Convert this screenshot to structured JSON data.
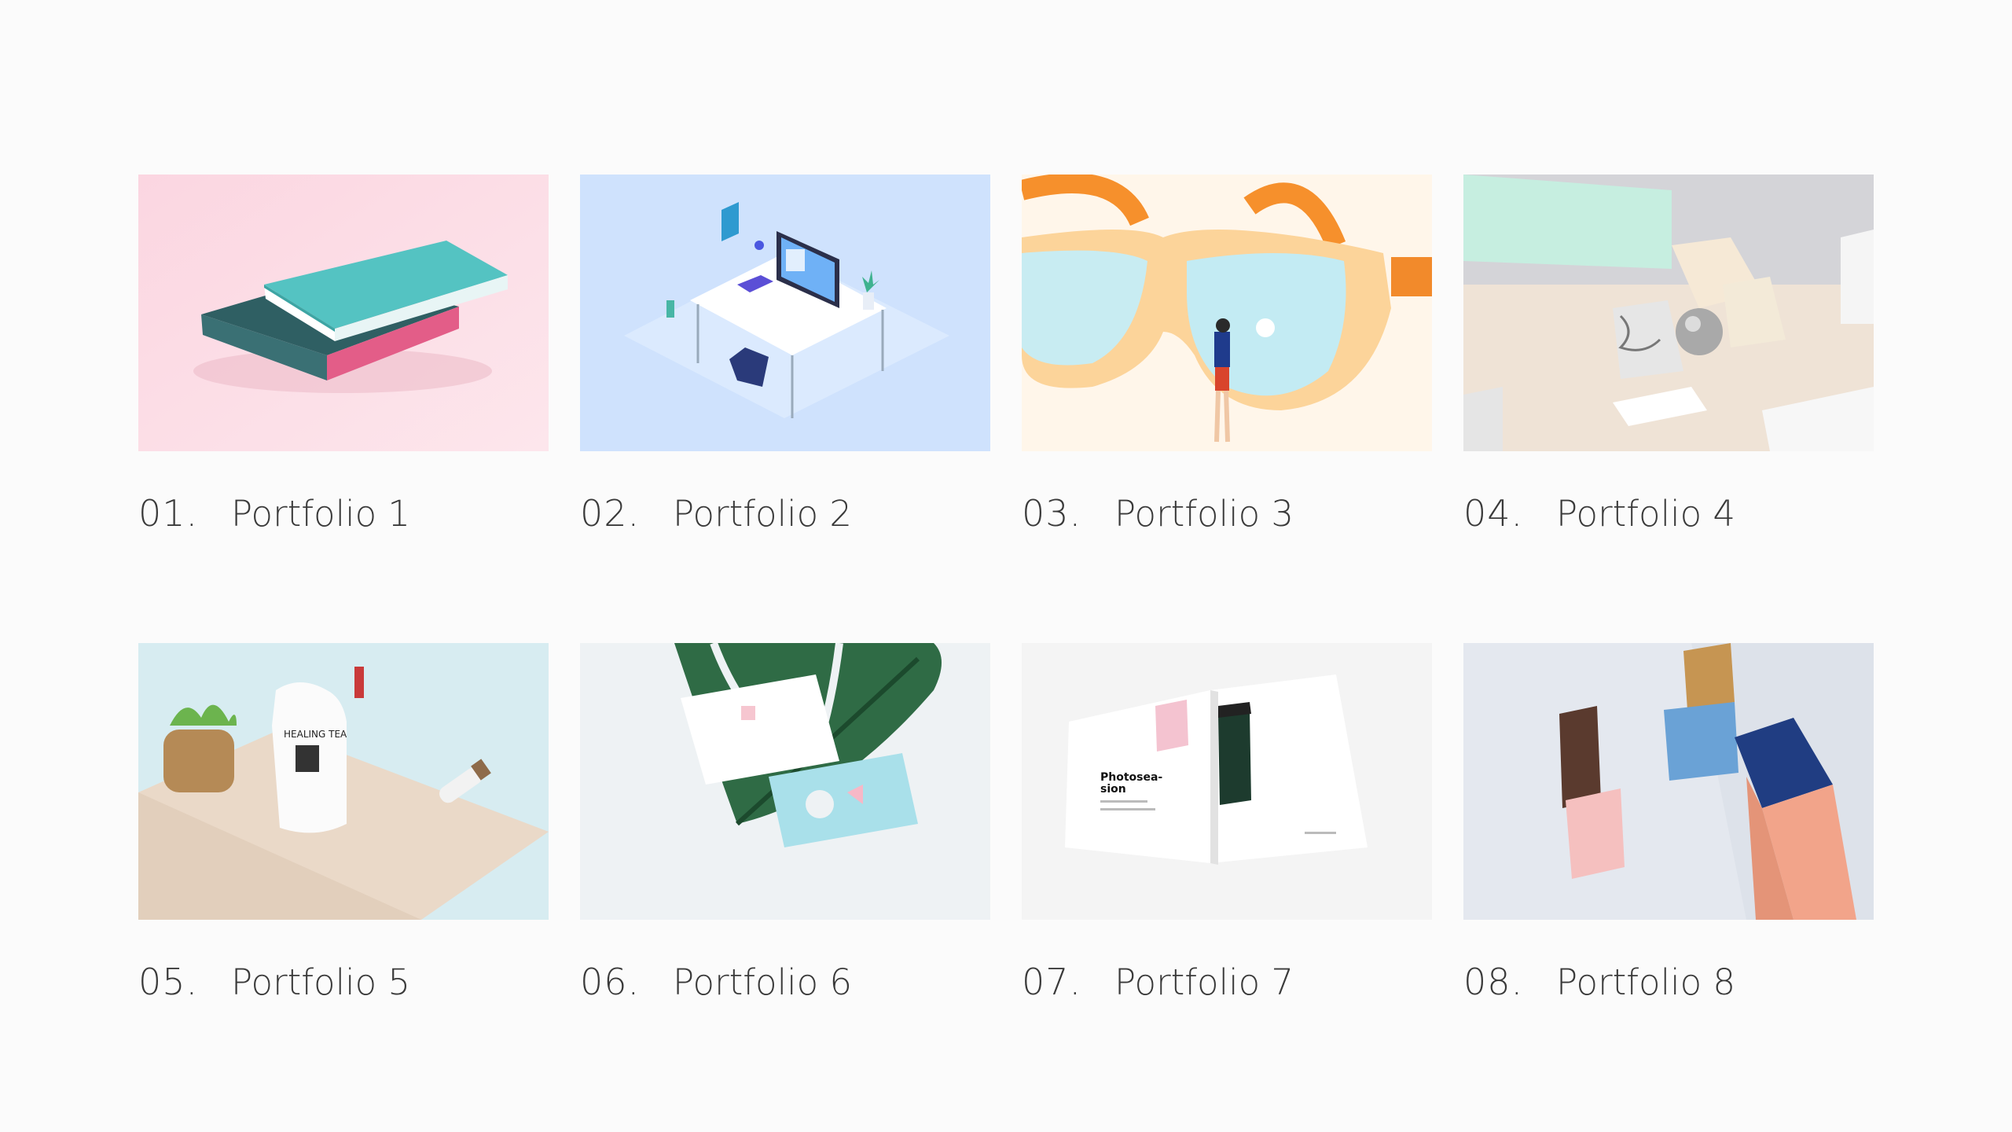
{
  "portfolio": {
    "items": [
      {
        "number": "01.",
        "title": "Portfolio 1",
        "image": "books-mockup-image",
        "bg": "#fde0e8"
      },
      {
        "number": "02.",
        "title": "Portfolio 2",
        "image": "isometric-workspace-image",
        "bg": "#cfe2fd"
      },
      {
        "number": "03.",
        "title": "Portfolio 3",
        "image": "sunglasses-illustration-image",
        "bg": "#fff6ea"
      },
      {
        "number": "04.",
        "title": "Portfolio 4",
        "image": "stationery-mockup-image",
        "bg": "#efe6dc"
      },
      {
        "number": "05.",
        "title": "Portfolio 5",
        "image": "tea-packaging-image",
        "bg": "#d7ecf1"
      },
      {
        "number": "06.",
        "title": "Portfolio 6",
        "image": "business-cards-leaf-image",
        "bg": "#eef2f4"
      },
      {
        "number": "07.",
        "title": "Portfolio 7",
        "image": "magazine-spread-image",
        "bg": "#f4f4f4"
      },
      {
        "number": "08.",
        "title": "Portfolio 8",
        "image": "boxes-mockup-image",
        "bg": "#e4e8ef"
      }
    ]
  }
}
